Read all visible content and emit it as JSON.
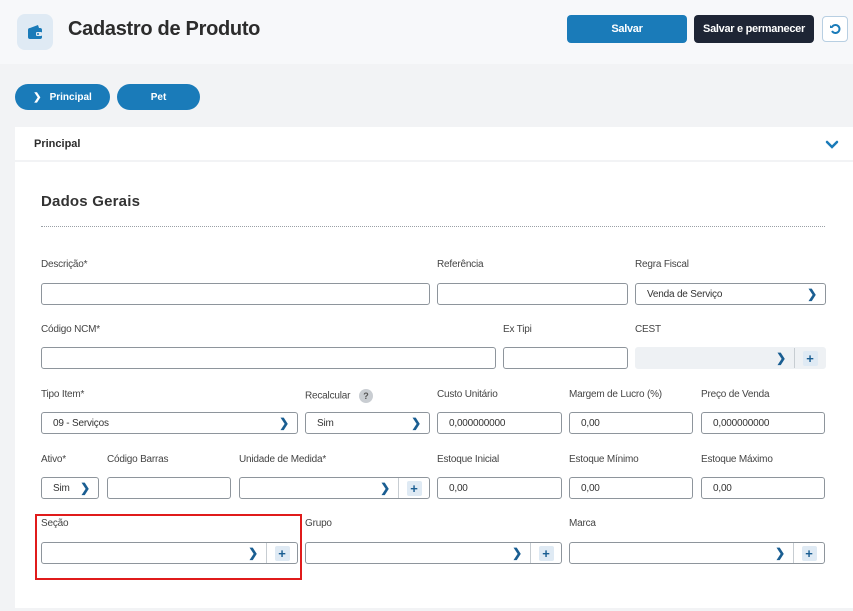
{
  "header": {
    "title": "Cadastro de Produto",
    "save_label": "Salvar",
    "save_stay_label": "Salvar e permanecer"
  },
  "tabs": [
    {
      "label": "Principal",
      "active": true
    },
    {
      "label": "Pet",
      "active": false
    }
  ],
  "section": {
    "title": "Principal"
  },
  "card": {
    "title": "Dados Gerais"
  },
  "fields": {
    "descricao": {
      "label": "Descrição*",
      "value": ""
    },
    "referencia": {
      "label": "Referência",
      "value": ""
    },
    "regra_fiscal": {
      "label": "Regra Fiscal",
      "value": "Venda de Serviço"
    },
    "codigo_ncm": {
      "label": "Código NCM*",
      "value": ""
    },
    "ex_tipi": {
      "label": "Ex Tipi",
      "value": ""
    },
    "cest": {
      "label": "CEST",
      "value": ""
    },
    "tipo_item": {
      "label": "Tipo Item*",
      "value": "09 - Serviços"
    },
    "recalcular": {
      "label": "Recalcular",
      "value": "Sim",
      "help": "?"
    },
    "custo_unitario": {
      "label": "Custo Unitário",
      "value": "0,000000000"
    },
    "margem_lucro": {
      "label": "Margem de Lucro (%)",
      "value": "0,00"
    },
    "preco_venda": {
      "label": "Preço de Venda",
      "value": "0,000000000"
    },
    "ativo": {
      "label": "Ativo*",
      "value": "Sim"
    },
    "codigo_barras": {
      "label": "Código Barras",
      "value": ""
    },
    "unidade_medida": {
      "label": "Unidade de Medida*",
      "value": ""
    },
    "estoque_inicial": {
      "label": "Estoque Inicial",
      "value": "0,00"
    },
    "estoque_minimo": {
      "label": "Estoque Mínimo",
      "value": "0,00"
    },
    "estoque_maximo": {
      "label": "Estoque Máximo",
      "value": "0,00"
    },
    "secao": {
      "label": "Seção",
      "value": ""
    },
    "grupo": {
      "label": "Grupo",
      "value": ""
    },
    "marca": {
      "label": "Marca",
      "value": ""
    }
  },
  "icons": {
    "app": "wallet-icon",
    "back": "undo-icon",
    "collapse": "chevron-down-icon",
    "select": "chevron-right-icon",
    "add": "plus-icon"
  },
  "colors": {
    "primary": "#1a7bb9",
    "dark": "#1e2535",
    "highlight": "#e01b1b"
  }
}
